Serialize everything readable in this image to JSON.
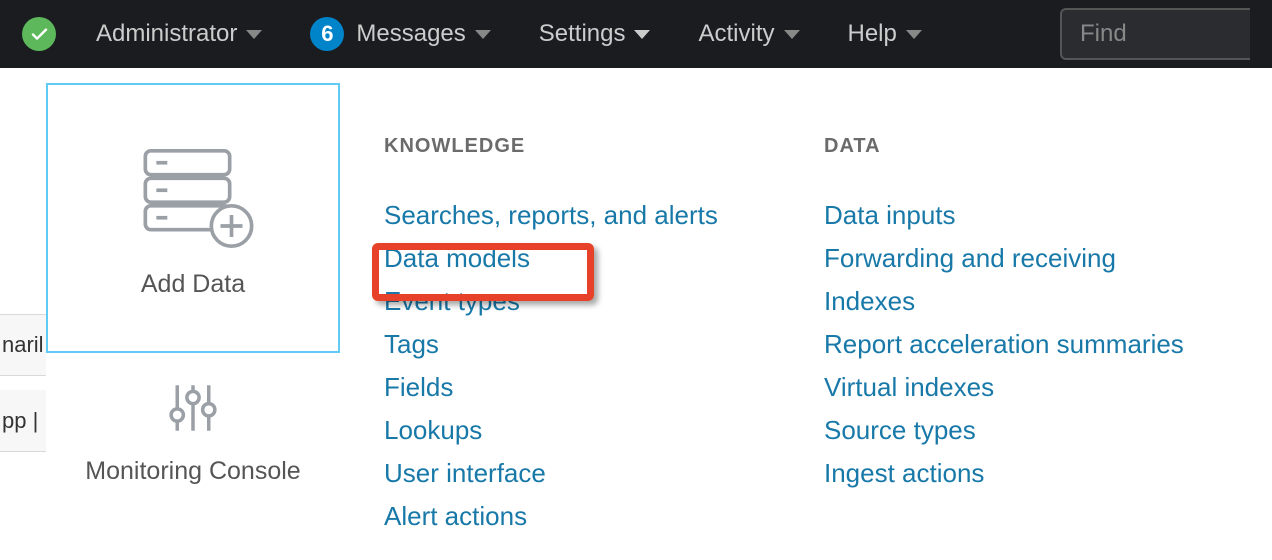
{
  "navbar": {
    "administrator": "Administrator",
    "messages_count": "6",
    "messages": "Messages",
    "settings": "Settings",
    "activity": "Activity",
    "help": "Help",
    "search_placeholder": "Find"
  },
  "bg": {
    "row1": "naril",
    "row2": "pp |"
  },
  "sidebar": {
    "add_data": "Add Data",
    "monitoring_console": "Monitoring Console"
  },
  "knowledge": {
    "header": "KNOWLEDGE",
    "items": [
      "Searches, reports, and alerts",
      "Data models",
      "Event types",
      "Tags",
      "Fields",
      "Lookups",
      "User interface",
      "Alert actions"
    ]
  },
  "data": {
    "header": "DATA",
    "items": [
      "Data inputs",
      "Forwarding and receiving",
      "Indexes",
      "Report acceleration summaries",
      "Virtual indexes",
      "Source types",
      "Ingest actions"
    ]
  }
}
